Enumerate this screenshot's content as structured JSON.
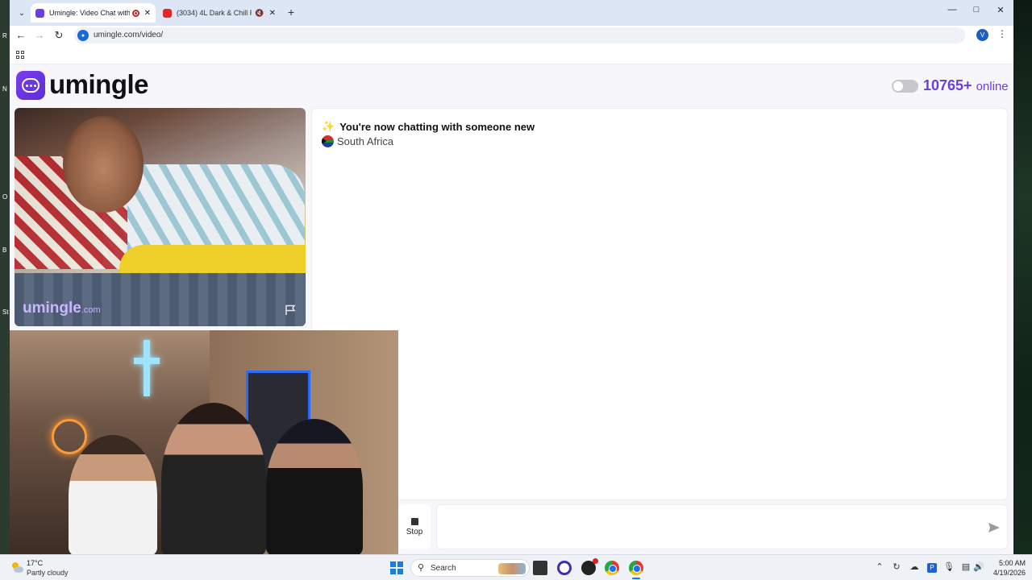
{
  "browser": {
    "tabs": [
      {
        "label": "Umingle: Video Chat with S",
        "active": true
      },
      {
        "label": "(3034) 4L Dark & Chill R&B",
        "active": false
      }
    ],
    "url": "umingle.com/video/",
    "profile_initial": "V"
  },
  "desktop": {
    "left_labels": [
      "R",
      "N",
      "O",
      "B",
      "St"
    ]
  },
  "site": {
    "logo": "umingle",
    "online_count": "10765+",
    "online_label": "online",
    "watermark": "umingle",
    "watermark_domain": ".com"
  },
  "chat": {
    "system_message": "You're now chatting with someone new",
    "country": "South Africa"
  },
  "controls": {
    "stop_label": "Stop",
    "message_placeholder": ""
  },
  "taskbar": {
    "temperature": "17°C",
    "weather": "Partly cloudy",
    "search_label": "Search",
    "time": "5:00 AM",
    "date": "4/19/2026"
  },
  "colors": {
    "brand": "#6a3ee0",
    "tabstrip": "#dde6f5",
    "page_bg": "#f7f7fb"
  }
}
